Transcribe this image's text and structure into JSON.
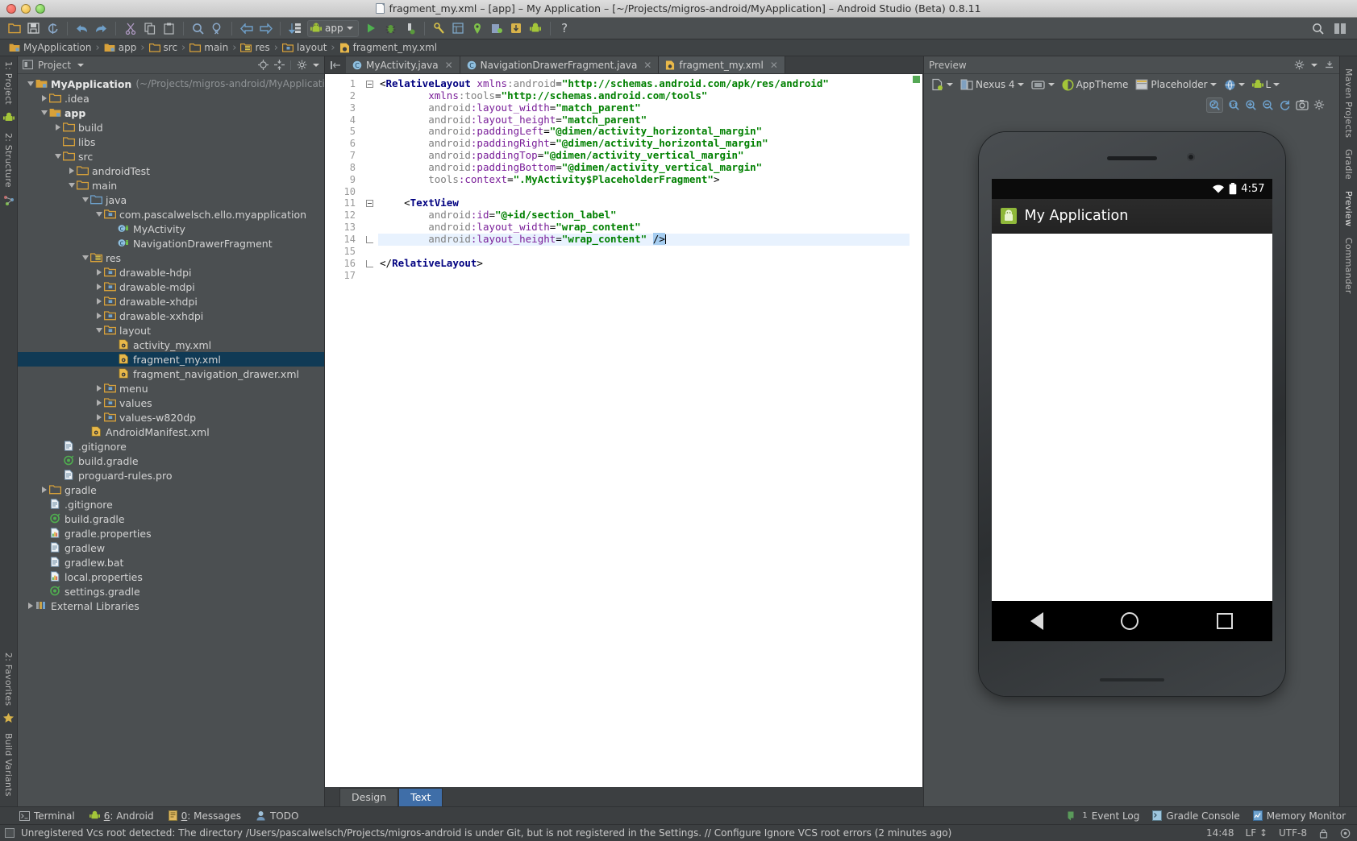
{
  "window": {
    "title": "fragment_my.xml – [app] – My Application – [~/Projects/migros-android/MyApplication] – Android Studio (Beta) 0.8.11"
  },
  "toolbar": {
    "run_config_label": "app",
    "icons": [
      "open-folder-icon",
      "save-all-icon",
      "sync-icon",
      "undo-icon",
      "redo-icon",
      "cut-icon",
      "copy-icon",
      "paste-icon",
      "find-icon",
      "find-replace-icon",
      "back-icon",
      "forward-icon",
      "compile-icon",
      "run-icon",
      "debug-icon",
      "android-monitor-icon",
      "sdk-manager-icon",
      "avd-manager-icon",
      "gradle-sync-icon",
      "project-structure-icon",
      "sdk-icon",
      "android-icon",
      "help-icon"
    ]
  },
  "breadcrumb": {
    "items": [
      {
        "label": "MyApplication",
        "icon": "module-folder-icon"
      },
      {
        "label": "app",
        "icon": "module-folder-icon"
      },
      {
        "label": "src",
        "icon": "folder-icon"
      },
      {
        "label": "main",
        "icon": "folder-icon"
      },
      {
        "label": "res",
        "icon": "res-folder-icon"
      },
      {
        "label": "layout",
        "icon": "res-folder-icon"
      },
      {
        "label": "fragment_my.xml",
        "icon": "xml-file-icon"
      }
    ]
  },
  "left_rail": {
    "top": [
      {
        "label": "1: Project",
        "icon": "project-icon"
      },
      {
        "label": "",
        "icon": "android-icon"
      },
      {
        "label": "2: Structure",
        "icon": "structure-icon"
      }
    ],
    "bottom": [
      {
        "label": "2: Favorites",
        "icon": "favorites-icon"
      },
      {
        "label": "Build Variants",
        "icon": "build-variants-icon"
      }
    ]
  },
  "right_rail": {
    "items": [
      {
        "label": "Maven Projects"
      },
      {
        "label": "Gradle"
      },
      {
        "label": "Preview"
      },
      {
        "label": "Commander"
      }
    ]
  },
  "project_panel": {
    "header_title": "Project",
    "header_icons": [
      "project-view-selector-icon",
      "chevron-down-icon",
      "locate-icon",
      "collapse-all-icon",
      "gear-icon"
    ],
    "tree": [
      {
        "depth": 0,
        "arrow": "down",
        "icon": "module-folder-icon",
        "label": "MyApplication",
        "bold": true,
        "dim": "(~/Projects/migros-android/MyApplication)",
        "selected": false
      },
      {
        "depth": 1,
        "arrow": "right",
        "icon": "folder-icon",
        "label": ".idea",
        "selected": false
      },
      {
        "depth": 1,
        "arrow": "down",
        "icon": "module-folder-icon",
        "label": "app",
        "bold": true,
        "selected": false
      },
      {
        "depth": 2,
        "arrow": "right",
        "icon": "folder-icon",
        "label": "build",
        "selected": false
      },
      {
        "depth": 2,
        "arrow": "none",
        "icon": "folder-icon",
        "label": "libs",
        "selected": false
      },
      {
        "depth": 2,
        "arrow": "down",
        "icon": "folder-icon",
        "label": "src",
        "selected": false
      },
      {
        "depth": 3,
        "arrow": "right",
        "icon": "folder-icon",
        "label": "androidTest",
        "selected": false
      },
      {
        "depth": 3,
        "arrow": "down",
        "icon": "folder-icon",
        "label": "main",
        "selected": false
      },
      {
        "depth": 4,
        "arrow": "down",
        "icon": "source-folder-icon",
        "label": "java",
        "selected": false
      },
      {
        "depth": 5,
        "arrow": "down",
        "icon": "package-icon",
        "label": "com.pascalwelsch.ello.myapplication",
        "selected": false
      },
      {
        "depth": 6,
        "arrow": "none",
        "icon": "java-class-icon",
        "label": "MyActivity",
        "selected": false
      },
      {
        "depth": 6,
        "arrow": "none",
        "icon": "java-class-icon",
        "label": "NavigationDrawerFragment",
        "selected": false
      },
      {
        "depth": 4,
        "arrow": "down",
        "icon": "res-folder-icon",
        "label": "res",
        "selected": false
      },
      {
        "depth": 5,
        "arrow": "right",
        "icon": "package-icon",
        "label": "drawable-hdpi",
        "selected": false
      },
      {
        "depth": 5,
        "arrow": "right",
        "icon": "package-icon",
        "label": "drawable-mdpi",
        "selected": false
      },
      {
        "depth": 5,
        "arrow": "right",
        "icon": "package-icon",
        "label": "drawable-xhdpi",
        "selected": false
      },
      {
        "depth": 5,
        "arrow": "right",
        "icon": "package-icon",
        "label": "drawable-xxhdpi",
        "selected": false
      },
      {
        "depth": 5,
        "arrow": "down",
        "icon": "package-icon",
        "label": "layout",
        "selected": false
      },
      {
        "depth": 6,
        "arrow": "none",
        "icon": "xml-file-icon",
        "label": "activity_my.xml",
        "selected": false
      },
      {
        "depth": 6,
        "arrow": "none",
        "icon": "xml-file-icon",
        "label": "fragment_my.xml",
        "selected": true
      },
      {
        "depth": 6,
        "arrow": "none",
        "icon": "xml-file-icon",
        "label": "fragment_navigation_drawer.xml",
        "selected": false
      },
      {
        "depth": 5,
        "arrow": "right",
        "icon": "package-icon",
        "label": "menu",
        "selected": false
      },
      {
        "depth": 5,
        "arrow": "right",
        "icon": "package-icon",
        "label": "values",
        "selected": false
      },
      {
        "depth": 5,
        "arrow": "right",
        "icon": "package-icon",
        "label": "values-w820dp",
        "selected": false
      },
      {
        "depth": 4,
        "arrow": "none",
        "icon": "xml-file-icon",
        "label": "AndroidManifest.xml",
        "selected": false
      },
      {
        "depth": 2,
        "arrow": "none",
        "icon": "text-file-icon",
        "label": ".gitignore",
        "selected": false
      },
      {
        "depth": 2,
        "arrow": "none",
        "icon": "gradle-file-icon",
        "label": "build.gradle",
        "selected": false
      },
      {
        "depth": 2,
        "arrow": "none",
        "icon": "text-file-icon",
        "label": "proguard-rules.pro",
        "selected": false
      },
      {
        "depth": 1,
        "arrow": "right",
        "icon": "folder-icon",
        "label": "gradle",
        "selected": false
      },
      {
        "depth": 1,
        "arrow": "none",
        "icon": "text-file-icon",
        "label": ".gitignore",
        "selected": false
      },
      {
        "depth": 1,
        "arrow": "none",
        "icon": "gradle-file-icon",
        "label": "build.gradle",
        "selected": false
      },
      {
        "depth": 1,
        "arrow": "none",
        "icon": "properties-file-icon",
        "label": "gradle.properties",
        "selected": false
      },
      {
        "depth": 1,
        "arrow": "none",
        "icon": "text-file-icon",
        "label": "gradlew",
        "selected": false
      },
      {
        "depth": 1,
        "arrow": "none",
        "icon": "text-file-icon",
        "label": "gradlew.bat",
        "selected": false
      },
      {
        "depth": 1,
        "arrow": "none",
        "icon": "properties-file-icon",
        "label": "local.properties",
        "selected": false
      },
      {
        "depth": 1,
        "arrow": "none",
        "icon": "gradle-file-icon",
        "label": "settings.gradle",
        "selected": false
      },
      {
        "depth": 0,
        "arrow": "right",
        "icon": "libraries-icon",
        "label": "External Libraries",
        "selected": false
      }
    ]
  },
  "editor": {
    "tabs": [
      {
        "label": "MyActivity.java",
        "icon": "java-class-icon",
        "active": false,
        "closable": true
      },
      {
        "label": "NavigationDrawerFragment.java",
        "icon": "java-class-icon",
        "active": false,
        "closable": true
      },
      {
        "label": "fragment_my.xml",
        "icon": "xml-file-icon",
        "active": true,
        "closable": true
      }
    ],
    "line_count": 17,
    "lines": [
      {
        "n": 1,
        "fold": "open",
        "marker": "class",
        "html": "<span class='punct'>&lt;</span><span class='tagname'>RelativeLayout</span> <span class='attr'>xmlns</span><span class='attrns'>:android</span><span class='punct'>=</span><span class='attrval'>\"http://schemas.android.com/apk/res/android\"</span>"
      },
      {
        "n": 2,
        "fold": "",
        "marker": "",
        "html": "        <span class='attr'>xmlns</span><span class='attrns'>:tools</span><span class='punct'>=</span><span class='attrval'>\"http://schemas.android.com/tools\"</span>"
      },
      {
        "n": 3,
        "fold": "",
        "marker": "",
        "html": "        <span class='attrns'>android</span><span class='attr'>:layout_width</span><span class='punct'>=</span><span class='attrval'>\"match_parent\"</span>"
      },
      {
        "n": 4,
        "fold": "",
        "marker": "",
        "html": "        <span class='attrns'>android</span><span class='attr'>:layout_height</span><span class='punct'>=</span><span class='attrval'>\"match_parent\"</span>"
      },
      {
        "n": 5,
        "fold": "",
        "marker": "",
        "html": "        <span class='attrns'>android</span><span class='attr'>:paddingLeft</span><span class='punct'>=</span><span class='attrval'>\"@dimen/activity_horizontal_margin\"</span>"
      },
      {
        "n": 6,
        "fold": "",
        "marker": "",
        "html": "        <span class='attrns'>android</span><span class='attr'>:paddingRight</span><span class='punct'>=</span><span class='attrval'>\"@dimen/activity_horizontal_margin\"</span>"
      },
      {
        "n": 7,
        "fold": "",
        "marker": "",
        "html": "        <span class='attrns'>android</span><span class='attr'>:paddingTop</span><span class='punct'>=</span><span class='attrval'>\"@dimen/activity_vertical_margin\"</span>"
      },
      {
        "n": 8,
        "fold": "",
        "marker": "",
        "html": "        <span class='attrns'>android</span><span class='attr'>:paddingBottom</span><span class='punct'>=</span><span class='attrval'>\"@dimen/activity_vertical_margin\"</span>"
      },
      {
        "n": 9,
        "fold": "",
        "marker": "",
        "html": "        <span class='attrns'>tools</span><span class='attr'>:context</span><span class='punct'>=</span><span class='attrval'>\".MyActivity$PlaceholderFragment\"</span><span class='punct'>&gt;</span>"
      },
      {
        "n": 10,
        "fold": "",
        "marker": "",
        "html": ""
      },
      {
        "n": 11,
        "fold": "open",
        "marker": "",
        "html": "    <span class='punct'>&lt;</span><span class='tagname'>TextView</span>"
      },
      {
        "n": 12,
        "fold": "",
        "marker": "",
        "html": "        <span class='attrns'>android</span><span class='attr'>:id</span><span class='punct'>=</span><span class='attrval'>\"@+id/section_label\"</span>"
      },
      {
        "n": 13,
        "fold": "",
        "marker": "",
        "html": "        <span class='attrns'>android</span><span class='attr'>:layout_width</span><span class='punct'>=</span><span class='attrval'>\"wrap_content\"</span>"
      },
      {
        "n": 14,
        "fold": "close",
        "marker": "bulb",
        "highlight": true,
        "html": "        <span class='attrns'>android</span><span class='attr'>:layout_height</span><span class='punct'>=</span><span class='attrval'>\"wrap_content\"</span> <span class='selbg'>/&gt;</span><span class='caret'></span>"
      },
      {
        "n": 15,
        "fold": "",
        "marker": "",
        "html": ""
      },
      {
        "n": 16,
        "fold": "close",
        "marker": "",
        "html": "<span class='punct'>&lt;/</span><span class='tagname'>RelativeLayout</span><span class='punct'>&gt;</span>"
      },
      {
        "n": 17,
        "fold": "",
        "marker": "",
        "html": ""
      }
    ],
    "design_text_tabs": [
      {
        "label": "Design",
        "active": false
      },
      {
        "label": "Text",
        "active": true
      }
    ]
  },
  "preview": {
    "header_title": "Preview",
    "header_icons": [
      "gear-icon",
      "minimize-icon"
    ],
    "toolbar": [
      {
        "label": "",
        "icon": "device-config-icon",
        "caret": true
      },
      {
        "label": "Nexus 4",
        "icon": "device-icon",
        "caret": true
      },
      {
        "label": "",
        "icon": "orientation-icon",
        "caret": true
      },
      {
        "label": "AppTheme",
        "icon": "theme-icon",
        "caret": false
      },
      {
        "label": "Placeholder",
        "icon": "activity-icon",
        "caret": true
      },
      {
        "label": "",
        "icon": "locale-globe-icon",
        "caret": true
      },
      {
        "label": "L",
        "icon": "android-api-icon",
        "caret": true
      }
    ],
    "zoom_tools": [
      "fit-to-screen-icon",
      "actual-size-icon",
      "zoom-in-icon",
      "zoom-out-icon",
      "refresh-icon",
      "screenshot-icon",
      "settings-icon"
    ],
    "device": {
      "status_time": "4:57",
      "status_icons": [
        "wifi-icon",
        "battery-icon"
      ],
      "app_title": "My Application",
      "app_icon": "android-app-icon",
      "nav_buttons": [
        "back-button",
        "home-button",
        "recents-button"
      ]
    }
  },
  "bottom_bar": {
    "items": [
      {
        "label": "Terminal",
        "icon": "terminal-icon",
        "mnemonic": ""
      },
      {
        "label": ": Android",
        "icon": "android-icon",
        "mnemonic": "6"
      },
      {
        "label": ": Messages",
        "icon": "messages-icon",
        "mnemonic": "0"
      },
      {
        "label": "TODO",
        "icon": "todo-icon",
        "mnemonic": ""
      }
    ],
    "right_items": [
      {
        "label": "Event Log",
        "icon": "event-log-icon",
        "badge": "1"
      },
      {
        "label": "Gradle Console",
        "icon": "gradle-console-icon"
      },
      {
        "label": "Memory Monitor",
        "icon": "memory-monitor-icon"
      }
    ]
  },
  "statusbar": {
    "message": "Unregistered Vcs root detected: The directory /Users/pascalwelsch/Projects/migros-android is under Git, but is not registered in the Settings. // Configure  Ignore VCS root errors (2 minutes ago)",
    "caret_position": "14:48",
    "line_separator": "LF",
    "encoding": "UTF-8"
  },
  "colors": {
    "panel_bg": "#4b4f51",
    "chrome_bg": "#3c3f41",
    "selection_blue": "#103a55",
    "tab_active_blue": "#3f6ea8",
    "editor_bg": "#ffffff",
    "android_green": "#a4c639"
  }
}
